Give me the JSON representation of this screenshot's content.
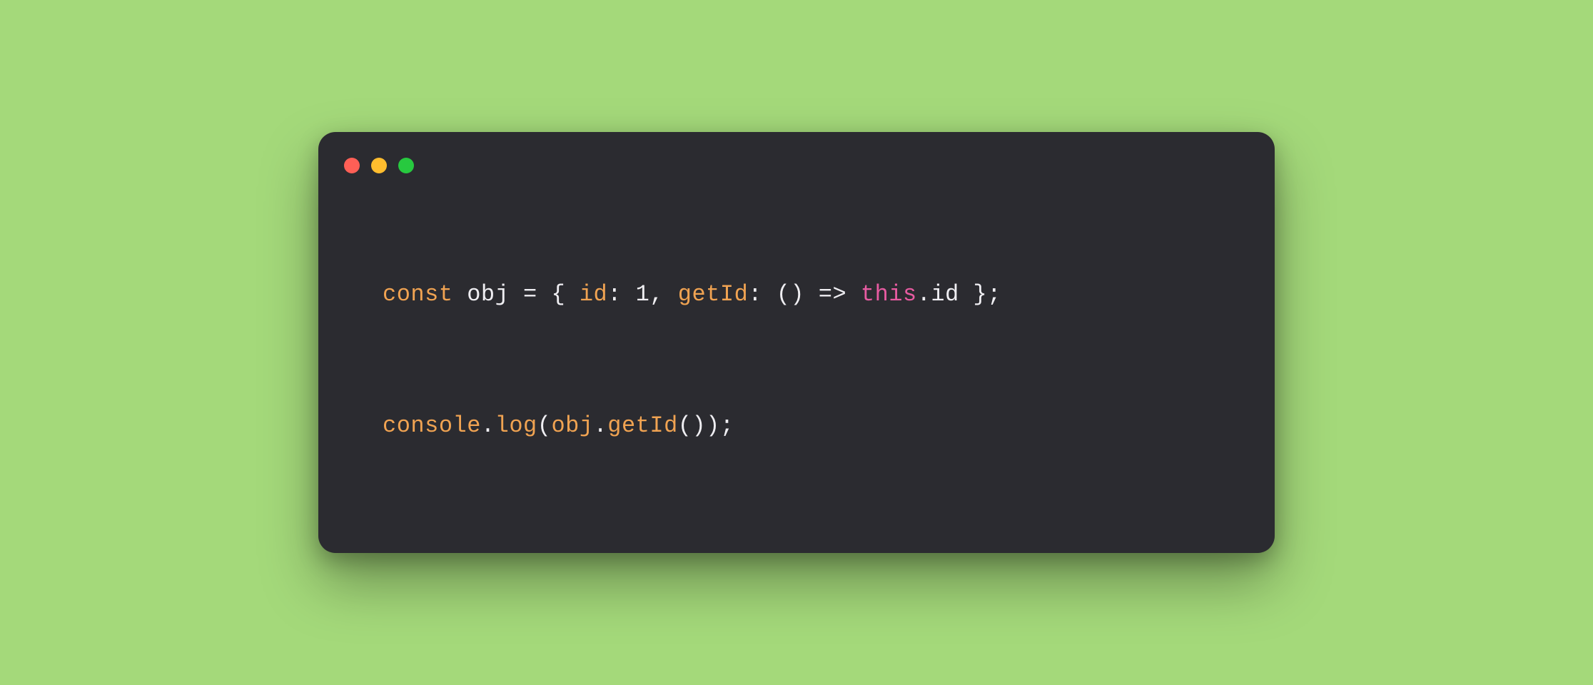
{
  "window": {
    "traffic_lights": [
      "close",
      "minimize",
      "zoom"
    ]
  },
  "code": {
    "line1": {
      "t0": "const",
      "t1": " obj ",
      "t2": "=",
      "t3": " { ",
      "t4": "id",
      "t5": ": ",
      "t6": "1",
      "t7": ", ",
      "t8": "getId",
      "t9": ": () ",
      "t10": "=>",
      "t11": " ",
      "t12": "this",
      "t13": ".id };"
    },
    "line2": {
      "t0": "console",
      "t1": ".",
      "t2": "log",
      "t3": "(",
      "t4": "obj",
      "t5": ".",
      "t6": "getId",
      "t7": "());"
    }
  }
}
